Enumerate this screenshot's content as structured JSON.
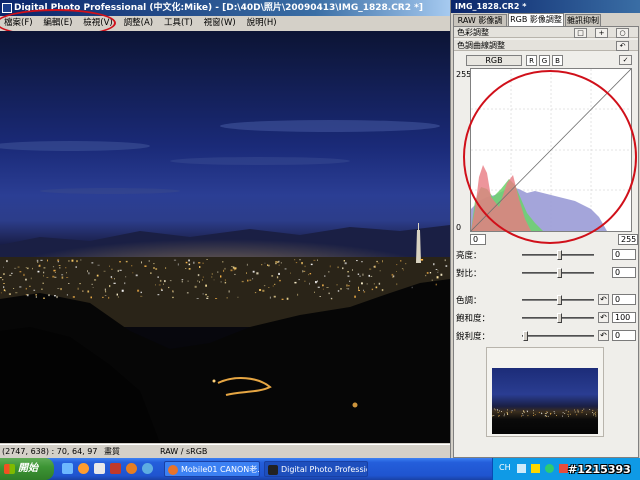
{
  "main_window": {
    "title": "Digital Photo Professional (中文化:Mike) - [D:\\40D\\照片\\20090413\\IMG_1828.CR2 *]"
  },
  "menubar": {
    "items": [
      "檔案(F)",
      "編輯(E)",
      "檢視(V)",
      "調整(A)",
      "工具(T)",
      "視窗(W)",
      "說明(H)"
    ]
  },
  "statusbar": {
    "coords": "(2747, 638) : 70, 64, 97",
    "quality": "畫質",
    "colorspace": "RAW / sRGB"
  },
  "palette": {
    "title": "IMG_1828.CR2 *",
    "tabs": [
      "RAW 影像調整",
      "RGB 影像調整",
      "雜訊抑制"
    ],
    "active_tab": 1,
    "color_adjust_label": "色彩調整",
    "tone_curve_label": "色調曲線調整",
    "channel": "RGB",
    "channel_buttons": [
      "R",
      "G",
      "B"
    ],
    "curve": {
      "input_max": "255",
      "input_min": "0",
      "out_min": "0",
      "out_max": "255"
    },
    "sliders": [
      {
        "label": "亮度：",
        "value": "0",
        "fraction": 0.5,
        "reset": false
      },
      {
        "label": "對比：",
        "value": "0",
        "fraction": 0.5,
        "reset": false
      },
      {
        "label": "色調：",
        "value": "0",
        "fraction": 0.5,
        "reset": true
      },
      {
        "label": "飽和度：",
        "value": "100",
        "fraction": 0.5,
        "reset": true
      },
      {
        "label": "銳利度：",
        "value": "0",
        "fraction": 0.02,
        "reset": true
      }
    ]
  },
  "taskbar": {
    "start_label": "開始",
    "tasks": [
      "Mobile01 CANON老...",
      "Digital Photo Professio..."
    ],
    "active_task": 1,
    "tray_lang": "CH"
  },
  "watermark": "#1215393",
  "colors": {
    "annotation": "#d0101a",
    "titlebar": "#0a246a",
    "taskbar": "#245edb"
  }
}
